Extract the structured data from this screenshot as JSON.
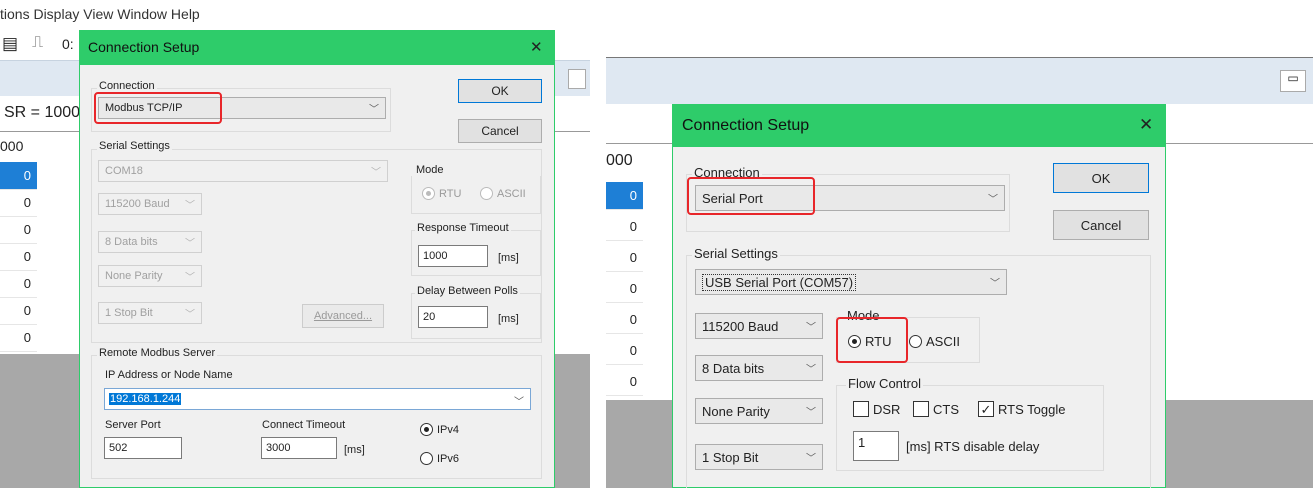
{
  "left": {
    "menu": {
      "label": "tions  Display  View  Window  Help"
    },
    "toolbar": {
      "partial_text": "0:"
    },
    "status": {
      "sr_text": "SR = 1000"
    },
    "table": {
      "header": "000",
      "rows": [
        "0",
        "0",
        "0",
        "0",
        "0",
        "0",
        "0"
      ]
    },
    "dialog": {
      "title": "Connection Setup",
      "close": "✕",
      "connection_label": "Connection",
      "connection_value": "Modbus TCP/IP",
      "ok": "OK",
      "cancel": "Cancel",
      "serial_label": "Serial Settings",
      "port": "COM18",
      "baud": "115200 Baud",
      "data_bits": "8 Data bits",
      "parity": "None Parity",
      "stop_bit": "1 Stop Bit",
      "advanced": "Advanced...",
      "mode_label": "Mode",
      "rtu": "RTU",
      "ascii": "ASCII",
      "response_timeout_label": "Response Timeout",
      "response_timeout_value": "1000",
      "ms": "[ms]",
      "delay_label": "Delay Between Polls",
      "delay_value": "20",
      "remote_label": "Remote Modbus Server",
      "ip_label": "IP Address or Node Name",
      "ip_value": "192.168.1.244",
      "server_port_label": "Server Port",
      "server_port_value": "502",
      "connect_timeout_label": "Connect Timeout",
      "connect_timeout_value": "3000",
      "ipv4": "IPv4",
      "ipv6": "IPv6"
    }
  },
  "right": {
    "table": {
      "header": "000",
      "rows": [
        "0",
        "0",
        "0",
        "0",
        "0",
        "0",
        "0"
      ]
    },
    "dialog": {
      "title": "Connection Setup",
      "close": "✕",
      "connection_label": "Connection",
      "connection_value": "Serial Port",
      "ok": "OK",
      "cancel": "Cancel",
      "serial_label": "Serial Settings",
      "port": "USB Serial Port (COM57)",
      "baud": "115200 Baud",
      "data_bits": "8 Data bits",
      "parity": "None Parity",
      "stop_bit": "1 Stop Bit",
      "mode_label": "Mode",
      "rtu": "RTU",
      "ascii": "ASCII",
      "flow_label": "Flow Control",
      "dsr": "DSR",
      "cts": "CTS",
      "rts_toggle": "RTS Toggle",
      "rts_delay_value": "1",
      "rts_delay_label": "[ms] RTS disable delay"
    }
  },
  "colors": {
    "title_green": "#2ecc6a",
    "highlight_red": "#e8262a",
    "selection_blue": "#1e7fd6"
  }
}
